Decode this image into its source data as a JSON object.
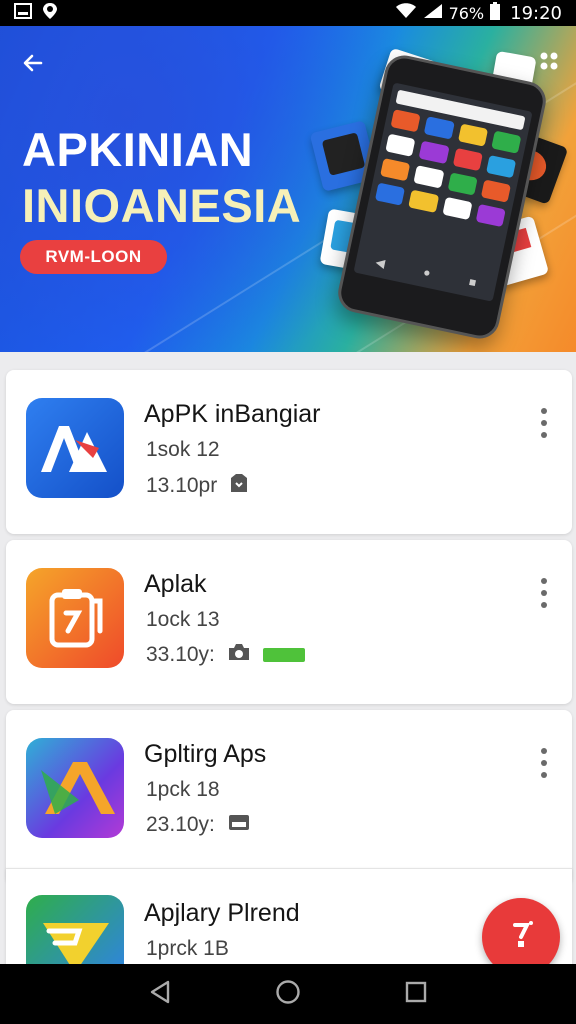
{
  "status_bar": {
    "battery_text": "76%",
    "time": "19:20",
    "icons": [
      "image-icon",
      "location-icon",
      "wifi-icon",
      "signal-icon",
      "battery-icon"
    ]
  },
  "hero": {
    "title_line1": "APKINIAN",
    "title_line2": "INIOANESIA",
    "button_label": "RVM-LOON",
    "icons": [
      "back-arrow-icon",
      "more-dots-icon"
    ]
  },
  "apps": [
    {
      "name": "ApPK inBangiar",
      "line2": "1sok 12",
      "line3": "13.10pr",
      "icon": "app-logo-icon",
      "extra_icon": "badge-icon"
    },
    {
      "name": "Aplak",
      "line2": "1ock 13",
      "line3": "33.10y:",
      "icon": "clipboard-icon",
      "extra_icon": "camera-icon"
    },
    {
      "name": "Gpltirg Aps",
      "line2": "1pck 18",
      "line3": "23.10y:",
      "icon": "triangle-logo-icon",
      "extra_icon": "card-icon"
    },
    {
      "name": "Apjlary Plrend",
      "line2": "1prck 1B",
      "line3": "",
      "icon": "flag-logo-icon",
      "extra_icon": ""
    }
  ],
  "fab": {
    "icon": "fab-action-icon"
  },
  "nav_bar": {
    "icons": [
      "back-triangle-icon",
      "home-circle-icon",
      "recents-square-icon"
    ]
  },
  "colors": {
    "accent_red": "#e94040",
    "hero_blue": "#1e5ff0",
    "hero_orange": "#f58a2a",
    "title_cream": "#f6f0b8"
  }
}
